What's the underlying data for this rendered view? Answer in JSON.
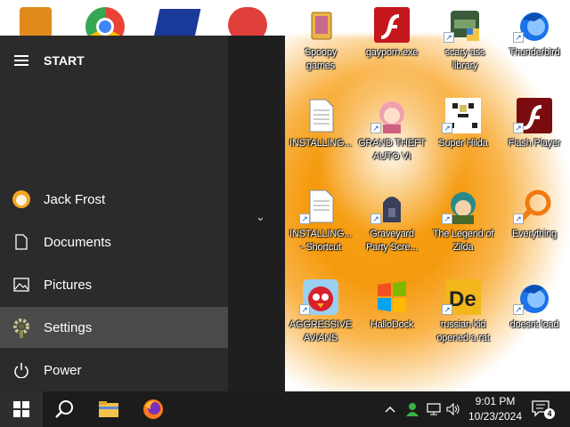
{
  "start_menu": {
    "title": "START",
    "user": "Jack Frost",
    "documents": "Documents",
    "pictures": "Pictures",
    "settings": "Settings",
    "power": "Power"
  },
  "desktop": {
    "icons": [
      {
        "label": "Spoopy\ngames",
        "icon": "folder-icon"
      },
      {
        "label": "gayporn.exe",
        "icon": "flash-icon"
      },
      {
        "label": "scary ass\nlibrary",
        "icon": "library-icon"
      },
      {
        "label": "Thunderbird",
        "icon": "thunderbird-icon"
      },
      {
        "label": "INSTALLING...",
        "icon": "document-icon"
      },
      {
        "label": "GRAND THEFT\nAUTO VI",
        "icon": "anime-girl-icon"
      },
      {
        "label": "Super Hilda",
        "icon": "pixel-art-icon"
      },
      {
        "label": "Flash Player",
        "icon": "flash-icon"
      },
      {
        "label": "INSTALLING...\n- Shortcut",
        "icon": "document-icon"
      },
      {
        "label": "Graveyard\nParty Scre...",
        "icon": "graveyard-icon"
      },
      {
        "label": "The Legend of\nZilda",
        "icon": "zilda-icon"
      },
      {
        "label": "Everything",
        "icon": "magnifier-icon"
      },
      {
        "label": "AGGRESSIVE\nAVIANS",
        "icon": "angry-bird-icon"
      },
      {
        "label": "HalloDock",
        "icon": "windows-logo-icon"
      },
      {
        "label": "russian kid\nopened a rat",
        "icon": "de-icon"
      },
      {
        "label": "doesnt load",
        "icon": "thunderbird-icon"
      }
    ]
  },
  "taskbar": {
    "time": "9:01 PM",
    "date": "10/23/2024",
    "notifications": "4"
  },
  "colors": {
    "start_bg": "#2b2b2b",
    "taskbar_bg": "#1c1c1c",
    "highlight": "#4a4a4a",
    "wallpaper_orange": "#f59a0e"
  }
}
